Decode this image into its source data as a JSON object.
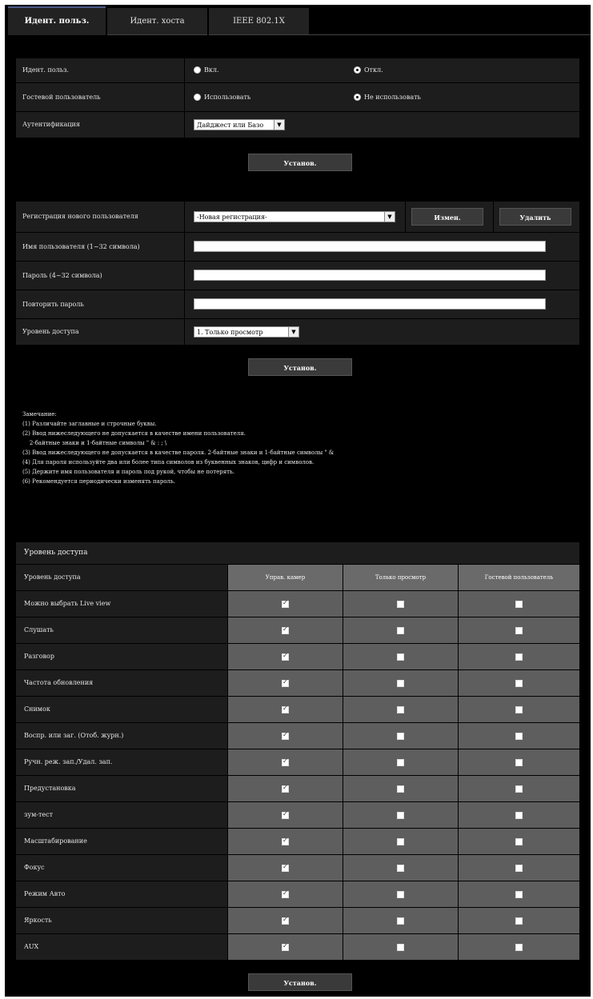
{
  "tabs": [
    "Идент. польз.",
    "Идент. хоста",
    "IEEE 802.1X"
  ],
  "auth_section": {
    "user_auth": {
      "label": "Идент. польз.",
      "options": [
        "Вкл.",
        "Откл."
      ],
      "selected": 1
    },
    "guest_user": {
      "label": "Гостевой пользователь",
      "options": [
        "Использовать",
        "Не использовать"
      ],
      "selected": 1
    },
    "authentication": {
      "label": "Аутентификация",
      "value": "Дайджест или Базо"
    },
    "set_button": "Установ."
  },
  "user_section": {
    "register_label": "Регистрация нового пользователя",
    "register_value": "-Новая регистрация-",
    "change_button": "Измен.",
    "delete_button": "Удалить",
    "username_label": "Имя пользователя (1~32 символа)",
    "password_label": "Пароль (4~32 символа)",
    "retype_label": "Повторить пароль",
    "access_label": "Уровень доступа",
    "access_value": "1. Только просмотр",
    "set_button": "Установ."
  },
  "notes": [
    "Замечание:",
    "(1) Различайте заглавные и строчные буквы.",
    "(2) Ввод нижеследующего не допускается в качестве имени пользователя.",
    "    2-байтные знаки и 1-байтные символы \" & : ; \\",
    "(3) Ввод нижеследующего не допускается в качестве пароля.   2-байтные знаки и 1-байтные символы \" &",
    "(4) Для пароля используйте два или более типа символов из буквенных знаков, цифр и символов.",
    "(5) Держите имя пользователя и пароль под рукой, чтобы не потерять.",
    "(6) Рекомендуется периодически изменять пароль."
  ],
  "permissions": {
    "title": "Уровень доступа",
    "header_label": "Уровень доступа",
    "columns": [
      "Управ. камер",
      "Только просмотр",
      "Гостевой пользователь"
    ],
    "rows": [
      {
        "label": "Можно выбрать Live view",
        "values": [
          true,
          false,
          false
        ]
      },
      {
        "label": "Слушать",
        "values": [
          true,
          false,
          false
        ]
      },
      {
        "label": "Разговор",
        "values": [
          true,
          false,
          false
        ]
      },
      {
        "label": "Частота обновления",
        "values": [
          true,
          false,
          false
        ]
      },
      {
        "label": "Снимок",
        "values": [
          true,
          false,
          false
        ]
      },
      {
        "label": "Воспр. или заг. (Отоб. журн.)",
        "values": [
          true,
          false,
          false
        ]
      },
      {
        "label": "Ручн. реж. зап./Удал. зап.",
        "values": [
          true,
          false,
          false
        ]
      },
      {
        "label": "Предустановка",
        "values": [
          true,
          false,
          false
        ]
      },
      {
        "label": "зум-тест",
        "values": [
          true,
          false,
          false
        ]
      },
      {
        "label": "Масштабирование",
        "values": [
          true,
          false,
          false
        ]
      },
      {
        "label": "Фокус",
        "values": [
          true,
          false,
          false
        ]
      },
      {
        "label": "Режим Авто",
        "values": [
          true,
          false,
          false
        ]
      },
      {
        "label": "Яркость",
        "values": [
          true,
          false,
          false
        ]
      },
      {
        "label": "AUX",
        "values": [
          true,
          false,
          false
        ]
      }
    ],
    "set_button": "Установ."
  }
}
